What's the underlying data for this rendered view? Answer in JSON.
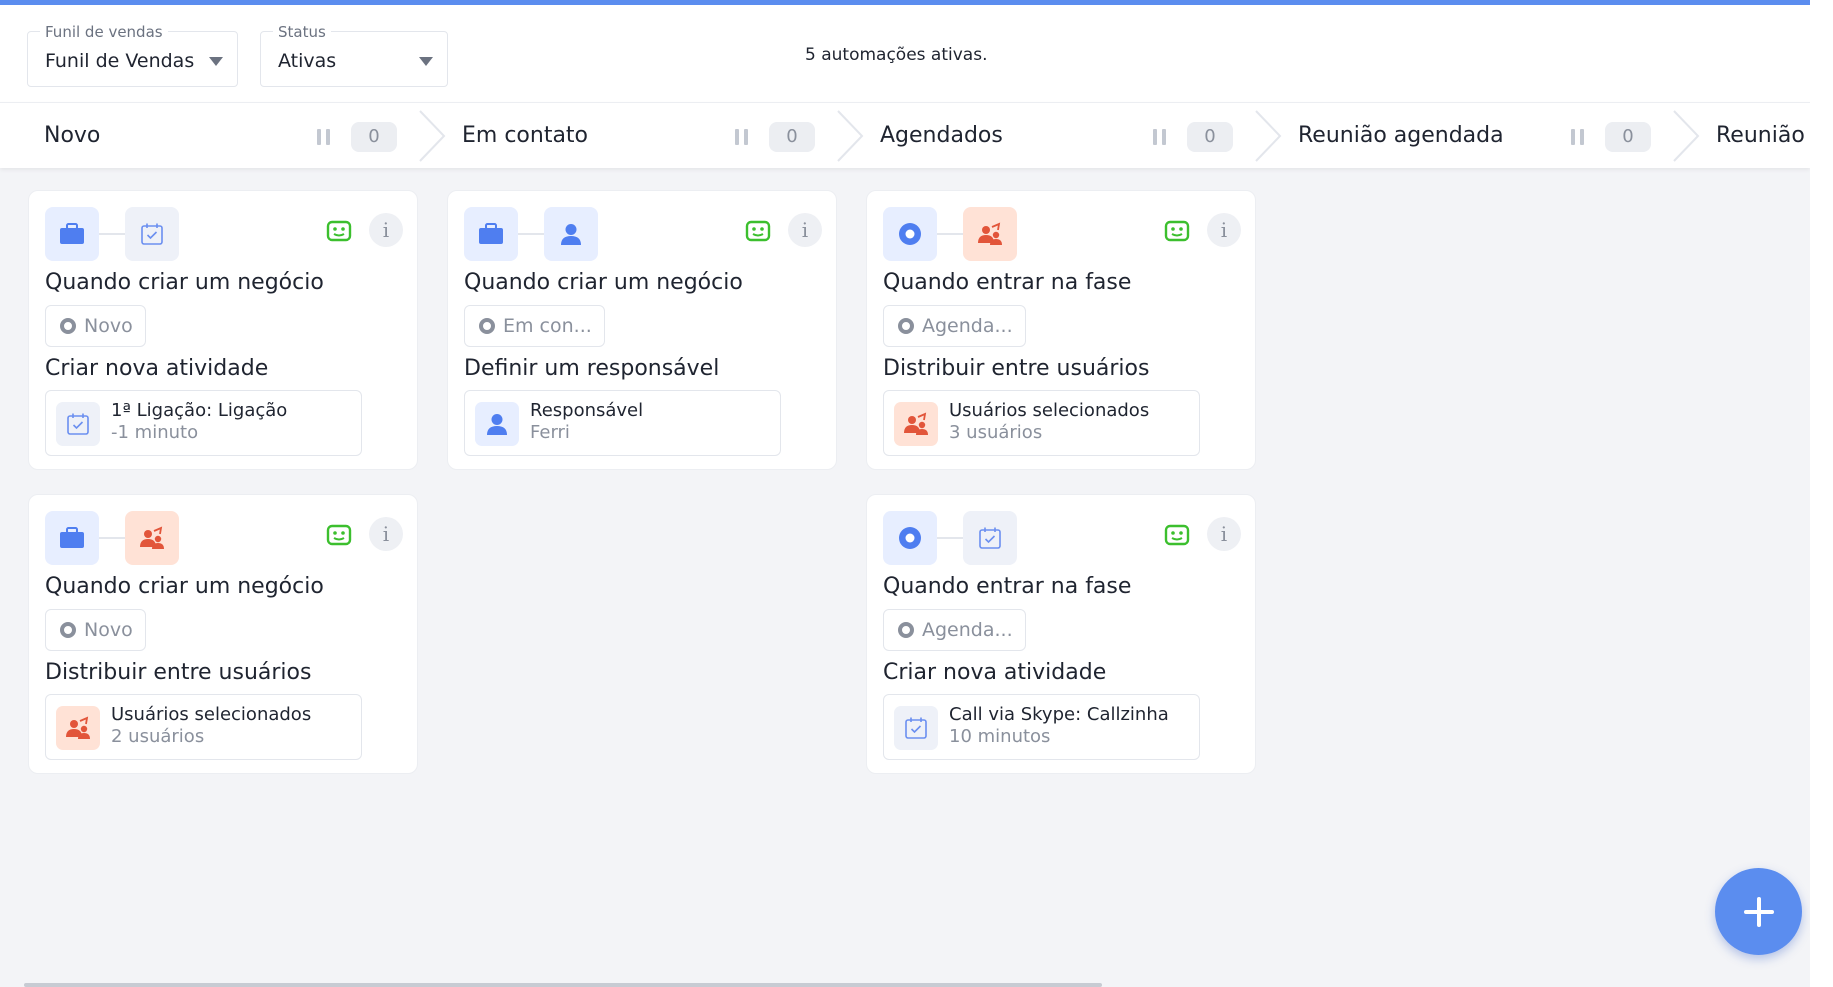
{
  "header": {
    "funnel_select": {
      "label": "Funil de vendas",
      "value": "Funil de Vendas"
    },
    "status_select": {
      "label": "Status",
      "value": "Ativas"
    },
    "summary": "5 automações ativas."
  },
  "stages": [
    {
      "name": "Novo",
      "count": "0"
    },
    {
      "name": "Em contato",
      "count": "0"
    },
    {
      "name": "Agendados",
      "count": "0"
    },
    {
      "name": "Reunião agendada",
      "count": "0"
    },
    {
      "name": "Reunião r",
      "count": ""
    }
  ],
  "cards": [
    {
      "icons": [
        "briefcase-icon",
        "calendar-check-icon"
      ],
      "trigger": "Quando criar um negócio",
      "stage_chip": "Novo",
      "action": "Criar nova atividade",
      "detail_icon": "calendar-check-icon",
      "detail_title": "1ª Ligação: Ligação",
      "detail_sub": "-1 minuto"
    },
    {
      "icons": [
        "briefcase-icon",
        "person-icon"
      ],
      "trigger": "Quando criar um negócio",
      "stage_chip": "Em con...",
      "action": "Definir um responsável",
      "detail_icon": "person-icon",
      "detail_title": "Responsável",
      "detail_sub": "Ferri"
    },
    {
      "icons": [
        "target-icon",
        "users-distribute-icon"
      ],
      "trigger": "Quando entrar na fase",
      "stage_chip": "Agenda...",
      "action": "Distribuir entre usuários",
      "detail_icon": "users-distribute-icon",
      "detail_title": "Usuários selecionados",
      "detail_sub": "3 usuários"
    },
    {
      "icons": [
        "briefcase-icon",
        "users-distribute-icon"
      ],
      "trigger": "Quando criar um negócio",
      "stage_chip": "Novo",
      "action": "Distribuir entre usuários",
      "detail_icon": "users-distribute-icon",
      "detail_title": "Usuários selecionados",
      "detail_sub": "2 usuários"
    },
    {
      "icons": [
        "target-icon",
        "calendar-check-icon"
      ],
      "trigger": "Quando entrar na fase",
      "stage_chip": "Agenda...",
      "action": "Criar nova atividade",
      "detail_icon": "calendar-check-icon",
      "detail_title": "Call via Skype: Callzinha",
      "detail_sub": "10 minutos"
    }
  ],
  "info_glyph": "i",
  "colors": {
    "accent": "#5b8def",
    "robot_green": "#3cbf2e",
    "orange": "#e2553a"
  }
}
